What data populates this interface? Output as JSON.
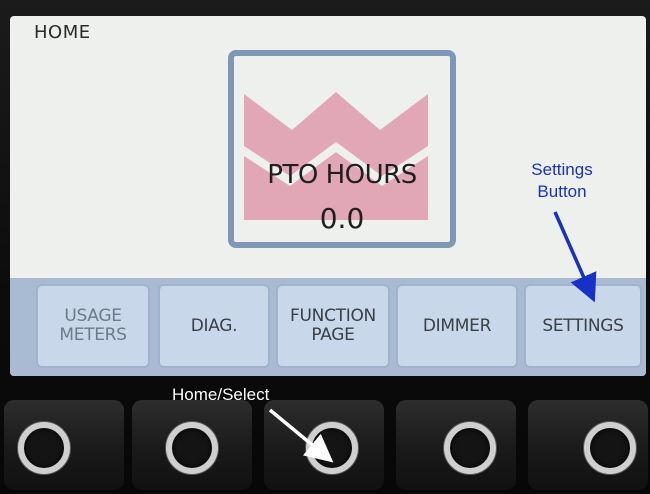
{
  "screen": {
    "title": "HOME",
    "pto": {
      "label": "PTO HOURS",
      "value": "0.0"
    }
  },
  "softkeys": [
    {
      "label": "USAGE\nMETERS",
      "state": "disabled"
    },
    {
      "label": "DIAG.",
      "state": "enabled"
    },
    {
      "label": "FUNCTION\nPAGE",
      "state": "enabled"
    },
    {
      "label": "DIMMER",
      "state": "enabled"
    },
    {
      "label": "SETTINGS",
      "state": "enabled"
    }
  ],
  "annotations": {
    "settings": "Settings\nButton",
    "home_select": "Home/Select",
    "settings_color": "#1630c8",
    "home_color": "#ffffff"
  },
  "colors": {
    "logo_pink": "#e2a7b6",
    "frame_blue": "#7f97b6",
    "softkey_bg": "#c8d7e9",
    "softkey_bar": "#a9bbd2"
  }
}
